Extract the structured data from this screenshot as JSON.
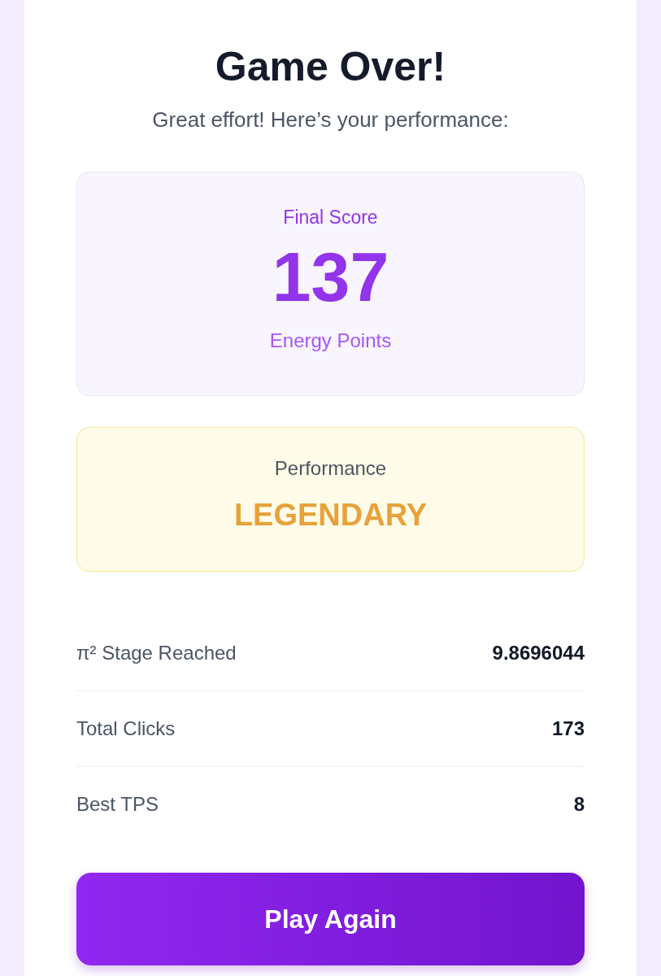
{
  "title": "Game Over!",
  "subtitle": "Great effort! Here’s your performance:",
  "score": {
    "label": "Final Score",
    "value": "137",
    "unit": "Energy Points"
  },
  "performance": {
    "label": "Performance",
    "rating": "LEGENDARY"
  },
  "stats": [
    {
      "label": "π² Stage Reached",
      "value": "9.8696044"
    },
    {
      "label": "Total Clicks",
      "value": "173"
    },
    {
      "label": "Best TPS",
      "value": "8"
    }
  ],
  "button": "Play Again"
}
